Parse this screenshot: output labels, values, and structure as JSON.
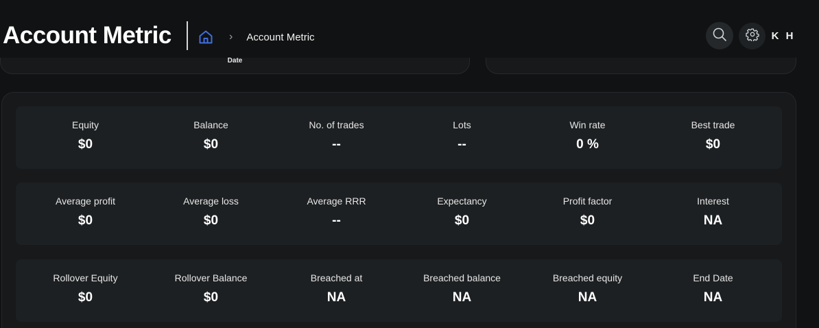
{
  "header": {
    "title": "Account Metric",
    "breadcrumb_current": "Account Metric",
    "avatar_initials": "K H"
  },
  "previous_section": {
    "left_card_label": "Date"
  },
  "icons": {
    "home": "home-icon",
    "breadcrumb_separator": "chevron-right-icon",
    "search": "search-icon",
    "settings": "gear-icon"
  },
  "colors": {
    "background": "#111213",
    "panel": "#17191b",
    "row": "#1d2022",
    "accent_home": "#3f6fe0"
  },
  "breadcrumb": {
    "separator": "›"
  },
  "metric_rows": [
    [
      {
        "label": "Equity",
        "value": "$0"
      },
      {
        "label": "Balance",
        "value": "$0"
      },
      {
        "label": "No. of trades",
        "value": "--"
      },
      {
        "label": "Lots",
        "value": "--"
      },
      {
        "label": "Win rate",
        "value": "0 %"
      },
      {
        "label": "Best trade",
        "value": "$0"
      }
    ],
    [
      {
        "label": "Average profit",
        "value": "$0"
      },
      {
        "label": "Average loss",
        "value": "$0"
      },
      {
        "label": "Average RRR",
        "value": "--"
      },
      {
        "label": "Expectancy",
        "value": "$0"
      },
      {
        "label": "Profit factor",
        "value": "$0"
      },
      {
        "label": "Interest",
        "value": "NA"
      }
    ],
    [
      {
        "label": "Rollover Equity",
        "value": "$0"
      },
      {
        "label": "Rollover Balance",
        "value": "$0"
      },
      {
        "label": "Breached at",
        "value": "NA"
      },
      {
        "label": "Breached balance",
        "value": "NA"
      },
      {
        "label": "Breached equity",
        "value": "NA"
      },
      {
        "label": "End Date",
        "value": "NA"
      }
    ]
  ]
}
